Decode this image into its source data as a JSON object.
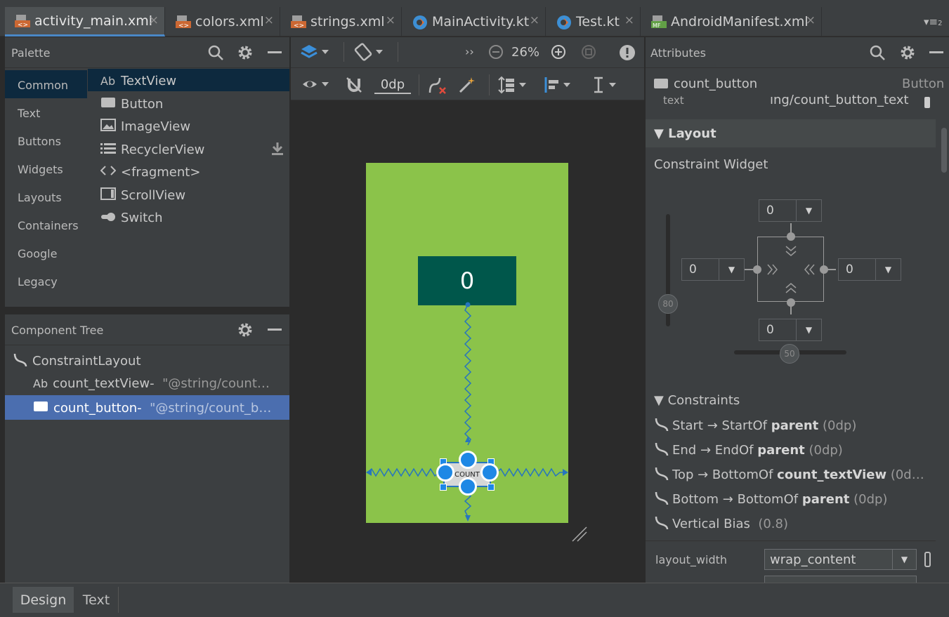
{
  "tabs": [
    {
      "label": "activity_main.xml",
      "icon": "layout-xml-icon",
      "active": true
    },
    {
      "label": "colors.xml",
      "icon": "values-xml-icon"
    },
    {
      "label": "strings.xml",
      "icon": "values-xml-icon"
    },
    {
      "label": "MainActivity.kt",
      "icon": "kotlin-file-icon"
    },
    {
      "label": "Test.kt",
      "icon": "kotlin-file-icon"
    },
    {
      "label": "AndroidManifest.xml",
      "icon": "manifest-icon"
    }
  ],
  "tab_close": "×",
  "tab_overflow": "▾≡",
  "tab_overflow_count": "2",
  "palette": {
    "title": "Palette",
    "categories": [
      "Common",
      "Text",
      "Buttons",
      "Widgets",
      "Layouts",
      "Containers",
      "Google",
      "Legacy"
    ],
    "items": [
      {
        "label": "TextView",
        "icon": "Ab"
      },
      {
        "label": "Button",
        "icon": "▬"
      },
      {
        "label": "ImageView",
        "icon": "▨"
      },
      {
        "label": "RecyclerView",
        "icon": "☰"
      },
      {
        "label": "<fragment>",
        "icon": "<>"
      },
      {
        "label": "ScrollView",
        "icon": "▭"
      },
      {
        "label": "Switch",
        "icon": "●"
      }
    ]
  },
  "component_tree": {
    "title": "Component Tree",
    "root": "ConstraintLayout",
    "rows": [
      {
        "icon": "Ab",
        "name": "count_textView-",
        "value": "\"@string/count…"
      },
      {
        "icon": "▬",
        "name": "count_button-",
        "value": "\"@string/count_b…"
      }
    ]
  },
  "toolbar": {
    "zoom": "26%",
    "margin": "0dp",
    "chevrons": "››"
  },
  "canvas": {
    "text_value": "0",
    "button_label": "COUNT"
  },
  "attributes": {
    "title": "Attributes",
    "component_name": "count_button",
    "component_type": "Button",
    "text_label": "text",
    "text_value": "ıng/count_button_text",
    "layout_section": "Layout",
    "constraint_widget_label": "Constraint Widget",
    "margins": {
      "top": "0",
      "left": "0",
      "right": "0",
      "bottom": "0"
    },
    "vertical_bias": "80",
    "horizontal_bias": "50",
    "constraints_section": "Constraints",
    "constraints": [
      {
        "side": "Start",
        "target": "StartOf",
        "ref": "parent",
        "margin": "(0dp)"
      },
      {
        "side": "End",
        "target": "EndOf",
        "ref": "parent",
        "margin": "(0dp)"
      },
      {
        "side": "Top",
        "target": "BottomOf",
        "ref": "count_textView",
        "margin": "(0d…"
      },
      {
        "side": "Bottom",
        "target": "BottomOf",
        "ref": "parent",
        "margin": "(0dp)"
      }
    ],
    "vertical_bias_row": {
      "label": "Vertical Bias",
      "value": "(0.8)"
    },
    "layout_width_label": "layout_width",
    "layout_width_value": "wrap_content"
  },
  "bottom_tabs": [
    "Design",
    "Text"
  ],
  "colors": {
    "accent": "#4a88c7",
    "canvas": "#8bc34a",
    "textview_bg": "#00574b",
    "selection": "#2675bf",
    "handle": "#1e88e5"
  }
}
